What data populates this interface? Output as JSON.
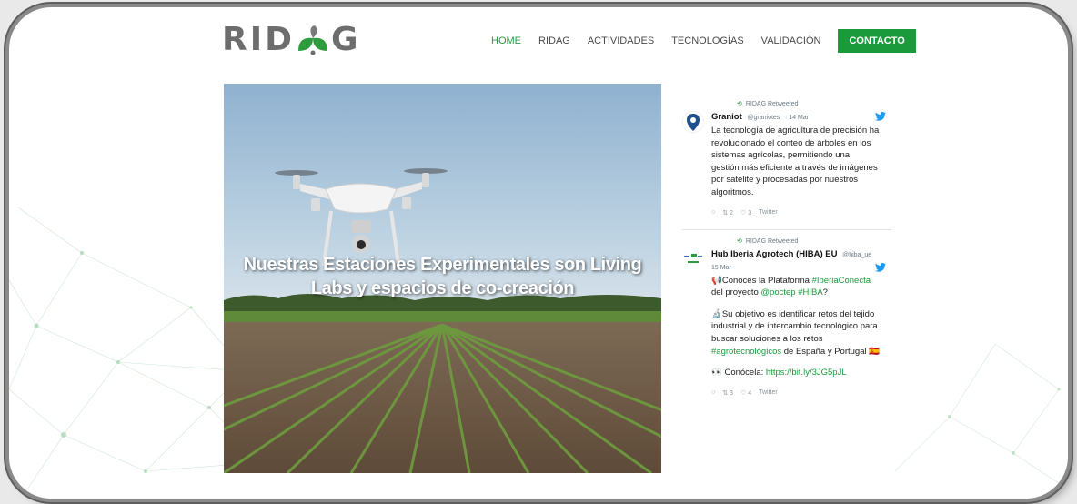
{
  "brand": {
    "logo_text_left": "RID",
    "logo_text_right": "G",
    "accent": "#1a9a3a"
  },
  "nav": {
    "items": [
      {
        "label": "HOME",
        "active": true
      },
      {
        "label": "RIDAG"
      },
      {
        "label": "ACTIVIDADES"
      },
      {
        "label": "TECNOLOGÍAS"
      },
      {
        "label": "VALIDACIÓN"
      },
      {
        "label": "CONTACTO",
        "cta": true
      }
    ]
  },
  "hero": {
    "title_line1": "Nuestras Estaciones Experimentales son Living",
    "title_line2": "Labs y espacios de co-creación"
  },
  "tweets": [
    {
      "retweet_label": "RIDAG Retweeted",
      "name": "Graniot",
      "handle": "@graniotes",
      "date": "· 14 Mar",
      "body": [
        "La tecnología de agricultura de precisión ha",
        "revolucionado el conteo de árboles en los",
        "sistemas agrícolas, permitiendo una",
        "gestión más eficiente a través de imágenes",
        "por satélite y procesadas por nuestros",
        "algoritmos."
      ],
      "retweets": "2",
      "likes": "3",
      "source": "Twitter"
    },
    {
      "retweet_label": "RIDAG Retweeted",
      "name": "Hub Iberia Agrotech (HIBA) EU",
      "handle": "@hiba_ue",
      "date": "15 Mar",
      "line1_prefix": "📢Conoces la Plataforma ",
      "line1_link": "#IberiaConecta",
      "line2_prefix": "del proyecto ",
      "line2_link": "@poctep #HIBA",
      "line2_suffix": "?",
      "para2": [
        "🔬Su objetivo es identificar retos del tejido",
        "industrial y de intercambio tecnológico para",
        "buscar soluciones a los retos"
      ],
      "line6_link": "#agrotecnológicos",
      "line6_suffix": " de España y Portugal 🇪🇸",
      "line7_prefix": "👀 Conócela: ",
      "line7_link": "https://bit.ly/3JG5pJL",
      "retweets": "3",
      "likes": "4",
      "source": "Twitter"
    }
  ]
}
